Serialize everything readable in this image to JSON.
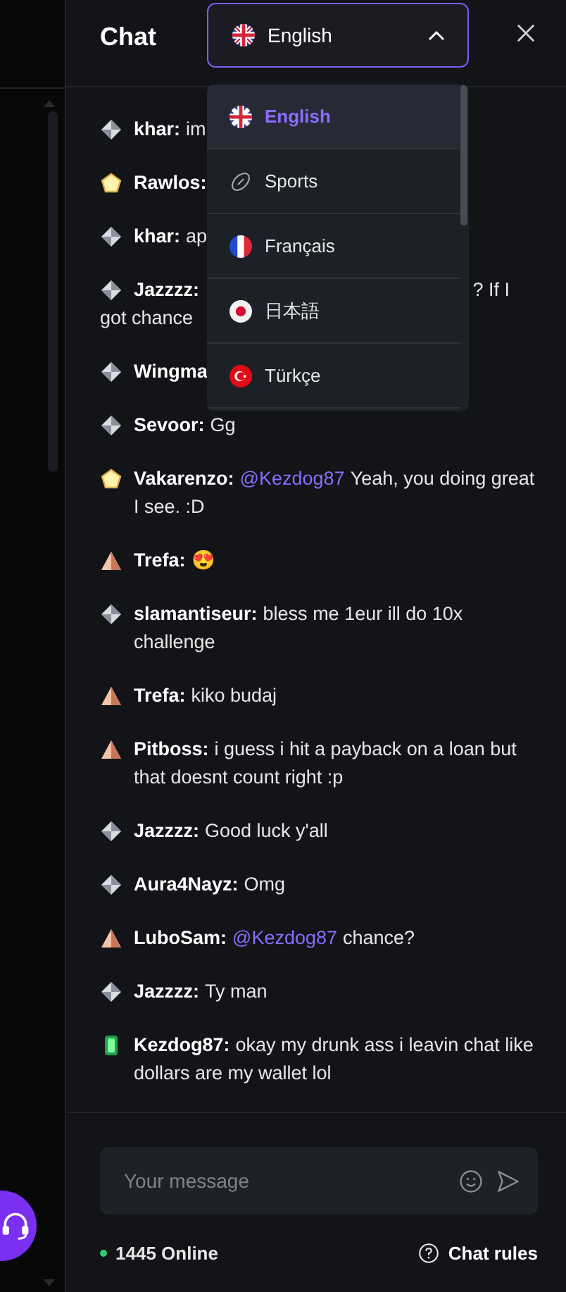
{
  "header": {
    "title": "Chat",
    "language_select": {
      "value": "English",
      "expanded": true
    }
  },
  "language_menu": [
    {
      "kind": "uk",
      "label": "English",
      "selected": true
    },
    {
      "kind": "sport",
      "label": "Sports",
      "selected": false
    },
    {
      "kind": "fr",
      "label": "Français",
      "selected": false
    },
    {
      "kind": "jp",
      "label": "日本語",
      "selected": false
    },
    {
      "kind": "tr",
      "label": "Türkçe",
      "selected": false
    }
  ],
  "messages": [
    {
      "kind": "silver",
      "user": "khar:",
      "text": "im"
    },
    {
      "kind": "gold",
      "user": "Rawlos:"
    },
    {
      "kind": "silver",
      "user": "khar:",
      "text": "ap"
    },
    {
      "kind": "silver",
      "user": "Jazzzz:",
      "tail": "? If I",
      "next_line": "got chance"
    },
    {
      "kind": "silver",
      "user": "Wingma"
    },
    {
      "kind": "silver",
      "user": "Sevoor:",
      "text": "Gg"
    },
    {
      "kind": "gold",
      "user": "Vakarenzo:",
      "mention": "@Kezdog87",
      "text": "Yeah, you doing great I see. :D"
    },
    {
      "kind": "bronze",
      "user": "Trefa:",
      "text": "😍"
    },
    {
      "kind": "silver",
      "user": "slamantiseur:",
      "text": "bless me 1eur ill do 10x challenge"
    },
    {
      "kind": "bronze",
      "user": "Trefa:",
      "text": "kiko budaj"
    },
    {
      "kind": "bronze",
      "user": "Pitboss:",
      "text": "i guess i hit a payback on a loan but that doesnt count right :p"
    },
    {
      "kind": "silver",
      "user": "Jazzzz:",
      "text": "Good luck y'all"
    },
    {
      "kind": "silver",
      "user": "Aura4Nayz:",
      "text": "Omg"
    },
    {
      "kind": "bronze",
      "user": "LuboSam:",
      "mention": "@Kezdog87",
      "text": "chance?"
    },
    {
      "kind": "silver",
      "user": "Jazzzz:",
      "text": "Ty man"
    },
    {
      "kind": "emerald",
      "user": "Kezdog87:",
      "text": "okay my drunk ass i leavin chat like dollars are my wallet lol"
    }
  ],
  "composer": {
    "placeholder": "Your message"
  },
  "footer": {
    "online": "1445 Online",
    "rules": "Chat rules"
  }
}
